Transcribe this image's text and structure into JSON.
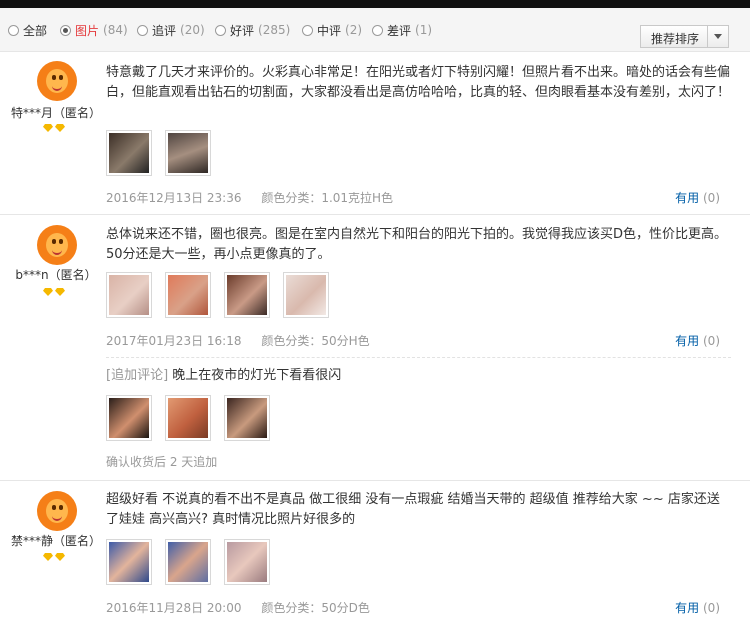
{
  "filters": [
    {
      "label": "全部",
      "count": "",
      "selected": false
    },
    {
      "label": "图片",
      "count": "(84)",
      "selected": true
    },
    {
      "label": "追评",
      "count": "(20)",
      "selected": false
    },
    {
      "label": "好评",
      "count": "(285)",
      "selected": false
    },
    {
      "label": "中评",
      "count": "(2)",
      "selected": false
    },
    {
      "label": "差评",
      "count": "(1)",
      "selected": false
    }
  ],
  "sort": {
    "label": "推荐排序"
  },
  "reviews": [
    {
      "user": "特***月（匿名）",
      "content": "特意戴了几天才来评价的。火彩真心非常足！在阳光或者灯下特别闪耀！但照片看不出来。暗处的话会有些偏白，但能直观看出钻石的切割面，大家都没看出是高仿哈哈哈，比真的轻、但肉眼看基本没有差别，太闪了！",
      "date": "2016年12月13日 23:36",
      "color": "颜色分类：1.01克拉H色",
      "useful_label": "有用",
      "useful_count": "(0)"
    },
    {
      "user": "b***n（匿名）",
      "content": "总体说来还不错，圈也很亮。图是在室内自然光下和阳台的阳光下拍的。我觉得我应该买D色，性价比更高。50分还是大一些，再小点更像真的了。",
      "date": "2017年01月23日 16:18",
      "color": "颜色分类：50分H色",
      "useful_label": "有用",
      "useful_count": "(0)",
      "append_label": "[追加评论]",
      "append_text": "晚上在夜市的灯光下看看很闪",
      "append_confirm": "确认收货后 2 天追加"
    },
    {
      "user": "禁***静（匿名）",
      "content": "超级好看 不说真的看不出不是真品 做工很细 没有一点瑕疵 结婚当天带的 超级值 推荐给大家 ~~ 店家还送了娃娃 高兴高兴? 真时情况比照片好很多的",
      "date": "2016年11月28日 20:00",
      "color": "颜色分类：50分D色",
      "useful_label": "有用",
      "useful_count": "(0)"
    }
  ]
}
